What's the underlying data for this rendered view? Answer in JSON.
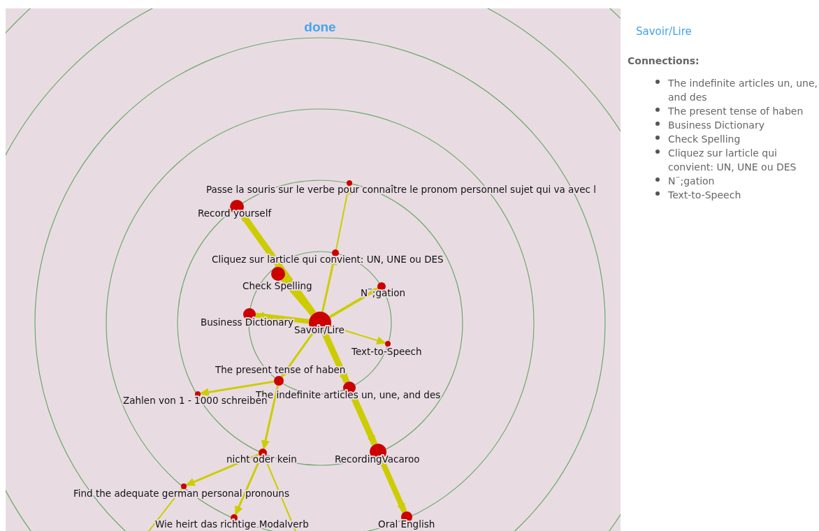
{
  "graph": {
    "title": "done",
    "nodes": [
      {
        "label": "Savoir/Lire"
      },
      {
        "label": "Passe la souris sur le verbe pour connaître le pronom personnel sujet qui va avec l"
      },
      {
        "label": "Record yourself"
      },
      {
        "label": "Cliquez sur larticle qui convient: UN, UNE ou DES"
      },
      {
        "label": "Check Spelling"
      },
      {
        "label": "N¨;gation"
      },
      {
        "label": "Business Dictionary"
      },
      {
        "label": "Text-to-Speech"
      },
      {
        "label": "The present tense of haben"
      },
      {
        "label": "The indefinite articles un, une, and des"
      },
      {
        "label": "Zahlen von 1 - 1000 schreiben"
      },
      {
        "label": "nicht oder kein"
      },
      {
        "label": "RecordingVacaroo"
      },
      {
        "label": "Find the adequate german personal pronouns"
      },
      {
        "label": "Wie heirt das richtige Modalverb"
      },
      {
        "label": "Oral English"
      }
    ]
  },
  "sidebar": {
    "title": "Savoir/Lire",
    "heading": "Connections:",
    "connections": [
      "The indefinite articles un, une, and des",
      "The present tense of haben",
      "Business Dictionary",
      "Check Spelling",
      "Cliquez sur larticle qui convient: UN, UNE ou DES",
      "N¨;gation",
      "Text-to-Speech"
    ]
  }
}
